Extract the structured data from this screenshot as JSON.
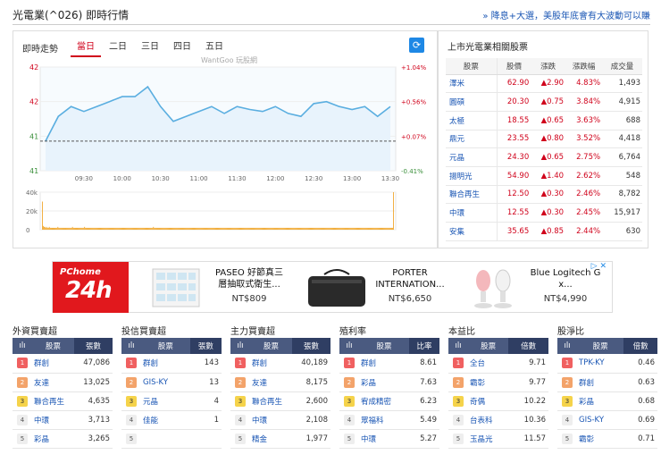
{
  "header": {
    "title": "光電業(^026) 即時行情",
    "link": "» 降息+大選，美股年底會有大波動可以賺"
  },
  "chart_panel": {
    "label": "即時走勢",
    "tabs": [
      "當日",
      "二日",
      "三日",
      "四日",
      "五日"
    ],
    "active_tab": "當日",
    "watermark": "WantGoo 玩股網"
  },
  "chart_data": [
    {
      "type": "line",
      "x": [
        "09:00",
        "09:10",
        "09:20",
        "09:30",
        "09:40",
        "09:50",
        "10:00",
        "10:10",
        "10:20",
        "10:30",
        "10:40",
        "10:50",
        "11:00",
        "11:10",
        "11:20",
        "11:30",
        "11:40",
        "11:50",
        "12:00",
        "12:10",
        "12:20",
        "12:30",
        "12:40",
        "12:50",
        "13:00",
        "13:10",
        "13:20",
        "13:30"
      ],
      "series": [
        {
          "values": [
            41.6,
            41.85,
            41.95,
            41.9,
            41.95,
            42.0,
            42.05,
            42.05,
            42.15,
            41.95,
            41.8,
            41.85,
            41.9,
            41.95,
            41.88,
            41.95,
            41.92,
            41.9,
            41.95,
            41.88,
            41.85,
            41.98,
            42.0,
            41.95,
            41.92,
            41.95,
            41.85,
            41.95
          ]
        }
      ],
      "x_ticks": [
        "09:30",
        "10:00",
        "10:30",
        "11:00",
        "11:30",
        "12:00",
        "12:30",
        "13:00",
        "13:30"
      ],
      "y_ticks_left": [
        "42",
        "42",
        "41",
        "41"
      ],
      "y_ticks_right": [
        "+1.04%",
        "+0.56%",
        "+0.07%",
        "-0.41%"
      ],
      "reference": 41.6,
      "line_color": "#5aaee0",
      "fill_color": "#e8f3fc"
    },
    {
      "type": "bar",
      "y_ticks": [
        "40k",
        "20k",
        "0"
      ],
      "bar_color": "#f0a830",
      "values": [
        30,
        4,
        3,
        3,
        2,
        3,
        2,
        2,
        3,
        2,
        2,
        2,
        2,
        2,
        2,
        2,
        2,
        2,
        3,
        2,
        2,
        2,
        2,
        2,
        2,
        2,
        2,
        2,
        2,
        2,
        2,
        2,
        2,
        2,
        2,
        3,
        2,
        2,
        2,
        2,
        2,
        2,
        2,
        2,
        2,
        2,
        2,
        2,
        2,
        3,
        2,
        2,
        2,
        2,
        2,
        2,
        2,
        2,
        2,
        2,
        2,
        2,
        2,
        2,
        2,
        2,
        2,
        2,
        2,
        2,
        2,
        2,
        2,
        2,
        2,
        2,
        2,
        2,
        2,
        2,
        2,
        2,
        2,
        2,
        2,
        2,
        2,
        2,
        2,
        2,
        2,
        2,
        2,
        2,
        2,
        2,
        2,
        2,
        2,
        2,
        2,
        2,
        2,
        2,
        2,
        2,
        2,
        2,
        2,
        2,
        2,
        2,
        2,
        2,
        2,
        2,
        2,
        2,
        2,
        2,
        2,
        2,
        2,
        2,
        2,
        2,
        2,
        2,
        2,
        3,
        2,
        2,
        2,
        2,
        2,
        2,
        2,
        2,
        2,
        2,
        2,
        2,
        2,
        2,
        2,
        2,
        2,
        2,
        2,
        2,
        2,
        2,
        2,
        2,
        2,
        2,
        2,
        2,
        2,
        2,
        2,
        2,
        2,
        2,
        2,
        2,
        2,
        2,
        2,
        2,
        2,
        2,
        2,
        2,
        2,
        2,
        2,
        2,
        2,
        2,
        2,
        2,
        2,
        2,
        2,
        2,
        2,
        2,
        2,
        2,
        2,
        2,
        2,
        2,
        2,
        2,
        2,
        2,
        2,
        2,
        2,
        2,
        2,
        2,
        2,
        2,
        2,
        2,
        2,
        2,
        2,
        2,
        2,
        2,
        2,
        2,
        2,
        2,
        2,
        2,
        2,
        2,
        2,
        2,
        2,
        2,
        2,
        2,
        2,
        2,
        2,
        2,
        2,
        2,
        2,
        2,
        2,
        2,
        2,
        2,
        2,
        2,
        2,
        2,
        2,
        2,
        2,
        2,
        2,
        2,
        2,
        2,
        2,
        2,
        2,
        2,
        2,
        2,
        2,
        2,
        2,
        2,
        2,
        2,
        2,
        2,
        2,
        2,
        2,
        2,
        2,
        2,
        2,
        2,
        2,
        2,
        2,
        2,
        2,
        2,
        2,
        2,
        2,
        2,
        2,
        2,
        2,
        2,
        2,
        2,
        2,
        2,
        2,
        2,
        2,
        2,
        2,
        2,
        2,
        2,
        2,
        2,
        2,
        2,
        2,
        2,
        2,
        2,
        2,
        2,
        2,
        2,
        2,
        2,
        2,
        2,
        2,
        2,
        2,
        2,
        2,
        2,
        2,
        2,
        2,
        2,
        2,
        2,
        2,
        2,
        2,
        2,
        2,
        2,
        2,
        2,
        2,
        2,
        2,
        2,
        2,
        2,
        2,
        2,
        2,
        2,
        2,
        2,
        2,
        2,
        2,
        2,
        2,
        2,
        2,
        2,
        2,
        2,
        2,
        2,
        2,
        2,
        2,
        2,
        2,
        2,
        2,
        2,
        2,
        2,
        2,
        2,
        2,
        2,
        2,
        2,
        2,
        2,
        2,
        2,
        2,
        2,
        2,
        2,
        2,
        2,
        2,
        2,
        2,
        2,
        2,
        2,
        2,
        2,
        2,
        2,
        2,
        2,
        2,
        2,
        2,
        2,
        2,
        2,
        2,
        2,
        2,
        2,
        40
      ]
    }
  ],
  "related": {
    "title": "上市光電業相關股票",
    "headers": [
      "股票",
      "股價",
      "漲跌",
      "漲跌幅",
      "成交量"
    ],
    "rows": [
      {
        "name": "澤米",
        "price": "62.90",
        "chg": "▲2.90",
        "pct": "4.83%",
        "vol": "1,493"
      },
      {
        "name": "圓碩",
        "price": "20.30",
        "chg": "▲0.75",
        "pct": "3.84%",
        "vol": "4,915"
      },
      {
        "name": "太極",
        "price": "18.55",
        "chg": "▲0.65",
        "pct": "3.63%",
        "vol": "688"
      },
      {
        "name": "鼎元",
        "price": "23.55",
        "chg": "▲0.80",
        "pct": "3.52%",
        "vol": "4,418"
      },
      {
        "name": "元晶",
        "price": "24.30",
        "chg": "▲0.65",
        "pct": "2.75%",
        "vol": "6,764"
      },
      {
        "name": "揚明光",
        "price": "54.90",
        "chg": "▲1.40",
        "pct": "2.62%",
        "vol": "548"
      },
      {
        "name": "聯合再生",
        "price": "12.50",
        "chg": "▲0.30",
        "pct": "2.46%",
        "vol": "8,782"
      },
      {
        "name": "中環",
        "price": "12.55",
        "chg": "▲0.30",
        "pct": "2.45%",
        "vol": "15,917"
      },
      {
        "name": "安集",
        "price": "35.65",
        "chg": "▲0.85",
        "pct": "2.44%",
        "vol": "630"
      }
    ]
  },
  "ad": {
    "logo_top": "PChome",
    "logo_big": "24h",
    "products": [
      {
        "name": "PASEO 好節真三層抽取式衛生...",
        "price": "NT$809"
      },
      {
        "name": "PORTER INTERNATION...",
        "price": "NT$6,650"
      },
      {
        "name": "Blue Logitech G x...",
        "price": "NT$4,990"
      }
    ],
    "icons": "▷ ✕"
  },
  "boards": [
    {
      "title": "外資買賣超",
      "h1": "股票",
      "h2": "張數",
      "rows": [
        [
          "1",
          "群創",
          "47,086"
        ],
        [
          "2",
          "友達",
          "13,025"
        ],
        [
          "3",
          "聯合再生",
          "4,635"
        ],
        [
          "4",
          "中環",
          "3,713"
        ],
        [
          "5",
          "彩晶",
          "3,265"
        ]
      ]
    },
    {
      "title": "投信買賣超",
      "h1": "股票",
      "h2": "張數",
      "rows": [
        [
          "1",
          "群創",
          "143"
        ],
        [
          "2",
          "GIS-KY",
          "13"
        ],
        [
          "3",
          "元晶",
          "4"
        ],
        [
          "4",
          "佳能",
          "1"
        ],
        [
          "5",
          "",
          ""
        ]
      ]
    },
    {
      "title": "主力買賣超",
      "h1": "股票",
      "h2": "張數",
      "rows": [
        [
          "1",
          "群創",
          "40,189"
        ],
        [
          "2",
          "友達",
          "8,175"
        ],
        [
          "3",
          "聯合再生",
          "2,600"
        ],
        [
          "4",
          "中環",
          "2,108"
        ],
        [
          "5",
          "精金",
          "1,977"
        ]
      ]
    },
    {
      "title": "殖利率",
      "h1": "股票",
      "h2": "比率",
      "rows": [
        [
          "1",
          "群創",
          "8.61"
        ],
        [
          "2",
          "彩晶",
          "7.63"
        ],
        [
          "3",
          "宥成精密",
          "6.23"
        ],
        [
          "4",
          "眾福科",
          "5.49"
        ],
        [
          "5",
          "中環",
          "5.27"
        ]
      ]
    },
    {
      "title": "本益比",
      "h1": "股票",
      "h2": "倍數",
      "rows": [
        [
          "1",
          "全台",
          "9.71"
        ],
        [
          "2",
          "霸彰",
          "9.77"
        ],
        [
          "3",
          "奇偶",
          "10.22"
        ],
        [
          "4",
          "台表科",
          "10.36"
        ],
        [
          "5",
          "玉晶光",
          "11.57"
        ]
      ]
    },
    {
      "title": "股淨比",
      "h1": "股票",
      "h2": "倍數",
      "rows": [
        [
          "1",
          "TPK-KY",
          "0.46"
        ],
        [
          "2",
          "群創",
          "0.63"
        ],
        [
          "3",
          "彩晶",
          "0.68"
        ],
        [
          "4",
          "GIS-KY",
          "0.69"
        ],
        [
          "5",
          "霸彰",
          "0.71"
        ]
      ]
    }
  ]
}
